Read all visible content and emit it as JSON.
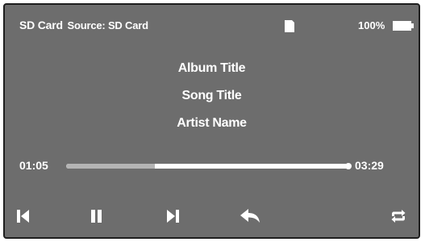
{
  "status": {
    "source_name": "SD Card",
    "source_label": "Source: SD Card",
    "battery": "100%",
    "battery_level": 1.0,
    "sd_icon": "sd-card-icon",
    "battery_icon": "battery-icon"
  },
  "track": {
    "album": "Album Title",
    "song": "Song Title",
    "artist": "Artist Name"
  },
  "progress": {
    "elapsed": "01:05",
    "total": "03:29",
    "fraction": 0.311
  },
  "controls": {
    "previous_icon": "skip-previous-icon",
    "pause_icon": "pause-icon",
    "next_icon": "skip-next-icon",
    "back_icon": "back-arrow-icon",
    "repeat_icon": "repeat-icon"
  },
  "colors": {
    "screen_bg": "#6d6d6d",
    "foreground": "#ffffff",
    "progress_fill": "#b4b4b4"
  }
}
